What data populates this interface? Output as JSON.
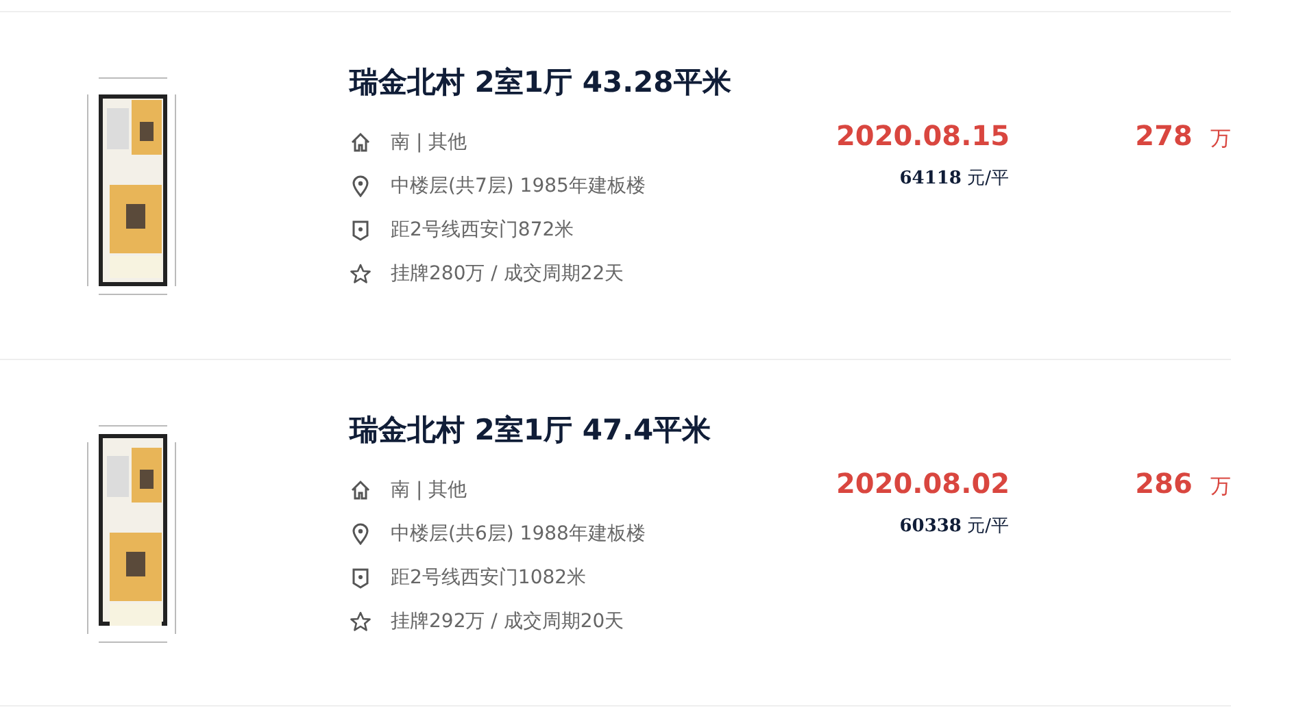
{
  "listings": [
    {
      "title": "瑞金北村 2室1厅 43.28平米",
      "info": [
        {
          "kind": "house",
          "text": "南 | 其他"
        },
        {
          "kind": "location",
          "text": "中楼层(共7层) 1985年建板楼"
        },
        {
          "kind": "badge",
          "text": "距2号线西安门872米"
        },
        {
          "kind": "star",
          "text": "挂牌280万 / 成交周期22天"
        }
      ],
      "deal_date": "2020.08.15",
      "unit_price": "64118",
      "unit_price_unit": "元/平",
      "total_price": "278",
      "total_unit": "万"
    },
    {
      "title": "瑞金北村 2室1厅 47.4平米",
      "info": [
        {
          "kind": "house",
          "text": "南 | 其他"
        },
        {
          "kind": "location",
          "text": "中楼层(共6层) 1988年建板楼"
        },
        {
          "kind": "badge",
          "text": "距2号线西安门1082米"
        },
        {
          "kind": "star",
          "text": "挂牌292万 / 成交周期20天"
        }
      ],
      "deal_date": "2020.08.02",
      "unit_price": "60338",
      "unit_price_unit": "元/平",
      "total_price": "286",
      "total_unit": "万"
    }
  ]
}
